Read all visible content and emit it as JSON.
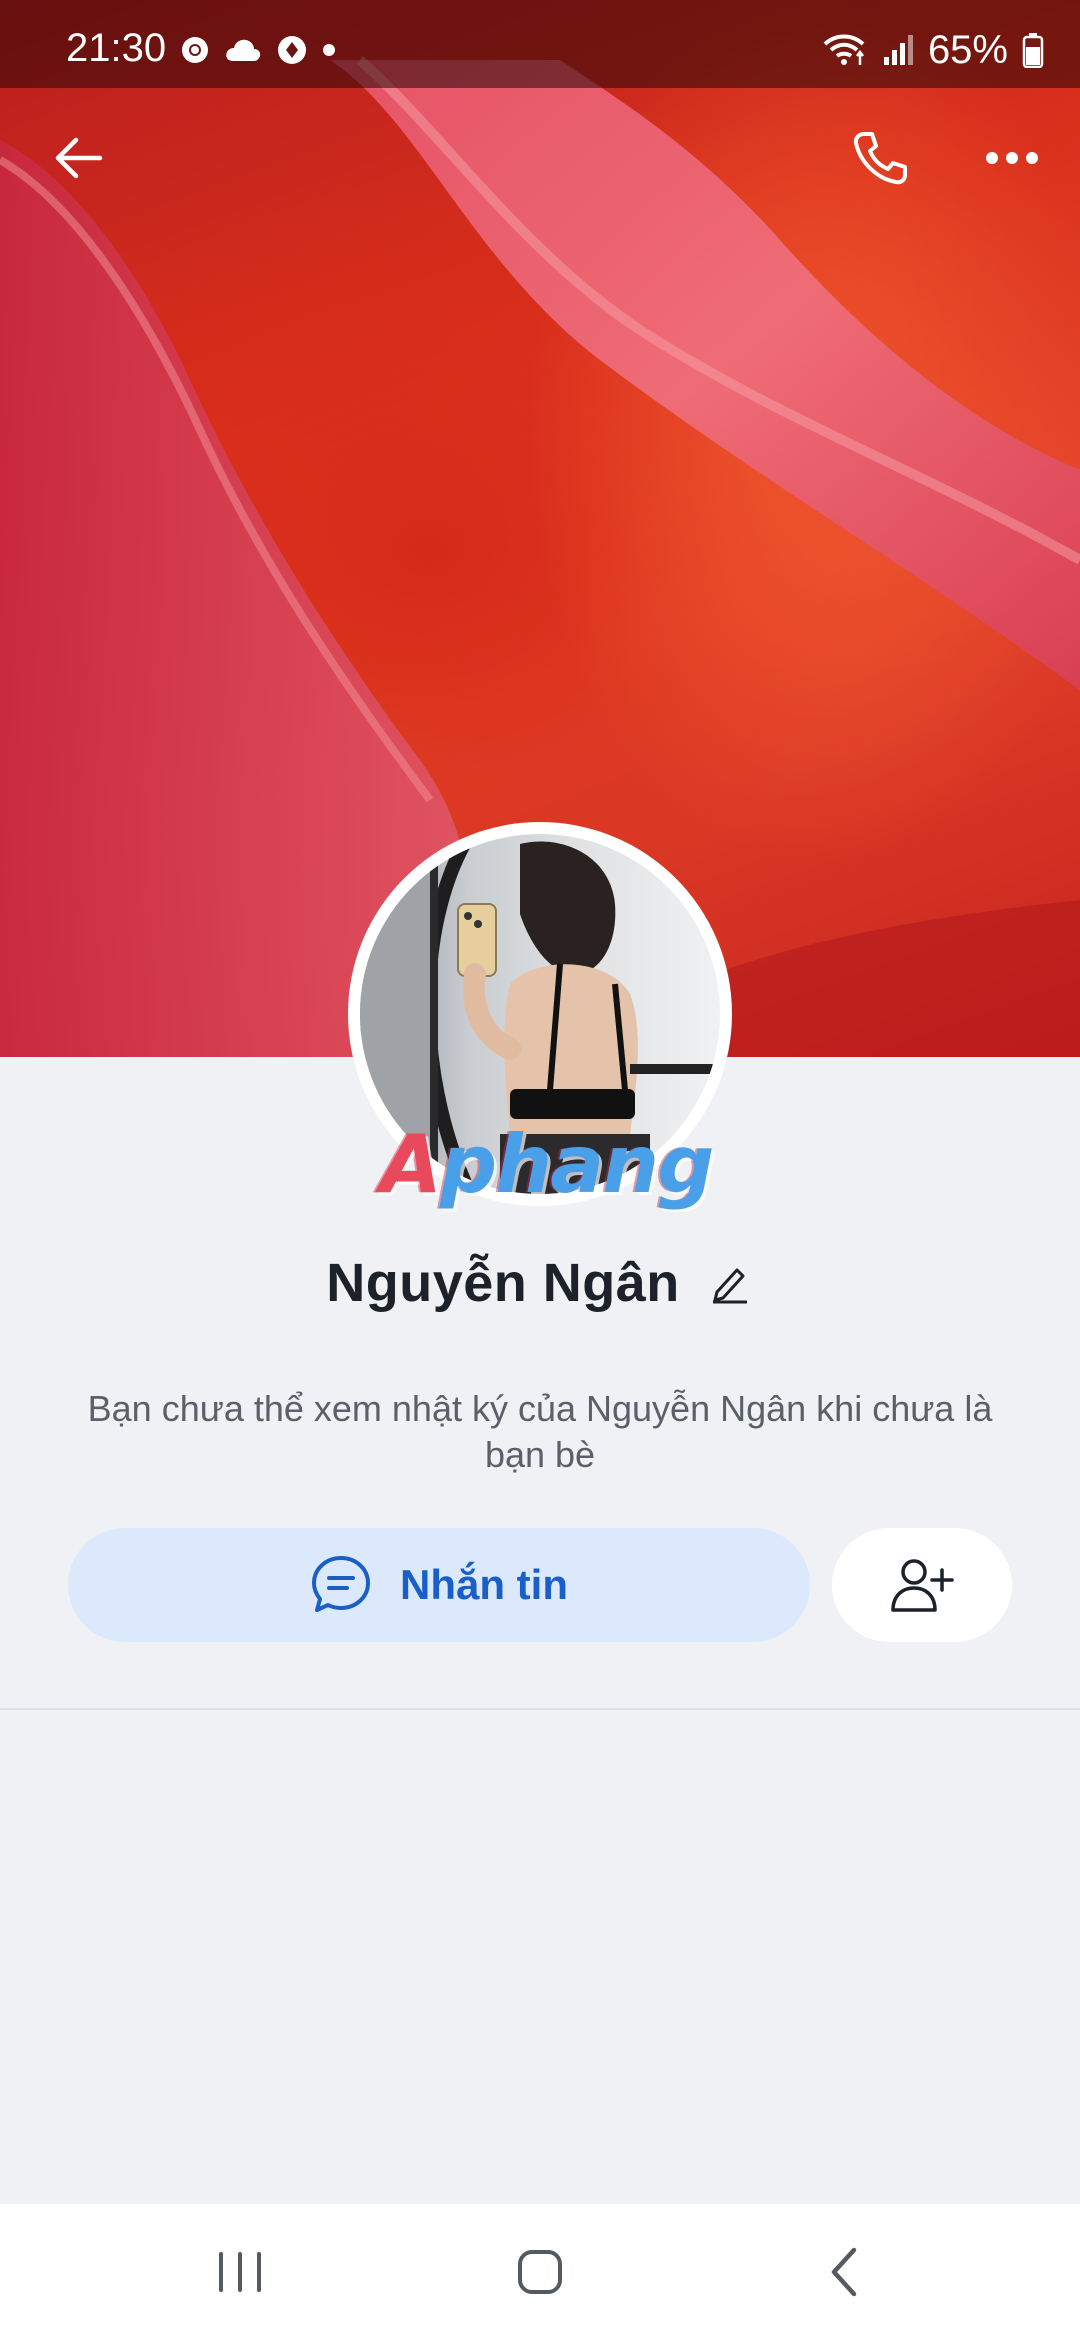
{
  "status_bar": {
    "time": "21:30",
    "battery_percent": "65%",
    "left_icons": [
      "chrome-icon",
      "cloud-icon",
      "sync-icon",
      "dot-icon"
    ],
    "right_icons": [
      "wifi-icon",
      "signal-icon",
      "battery-icon"
    ]
  },
  "top_bar": {
    "back_icon": "arrow-left-icon",
    "call_icon": "phone-icon",
    "more_icon": "more-dots-icon"
  },
  "profile": {
    "name": "Nguyễn Ngân",
    "watermark": "Aphang"
  },
  "privacy_note": "Bạn chưa thể xem nhật ký của Nguyễn Ngân khi chưa là bạn bè",
  "actions": {
    "message_label": "Nhắn tin",
    "message_icon": "chat-bubble-icon",
    "add_friend_icon": "add-user-icon"
  },
  "nav_bar": {
    "items": [
      "recents-icon",
      "home-icon",
      "back-chevron-icon"
    ]
  },
  "colors": {
    "accent": "#1a5fc8",
    "message_button_bg": "#dce9fc",
    "page_bg": "#eff1f5"
  }
}
